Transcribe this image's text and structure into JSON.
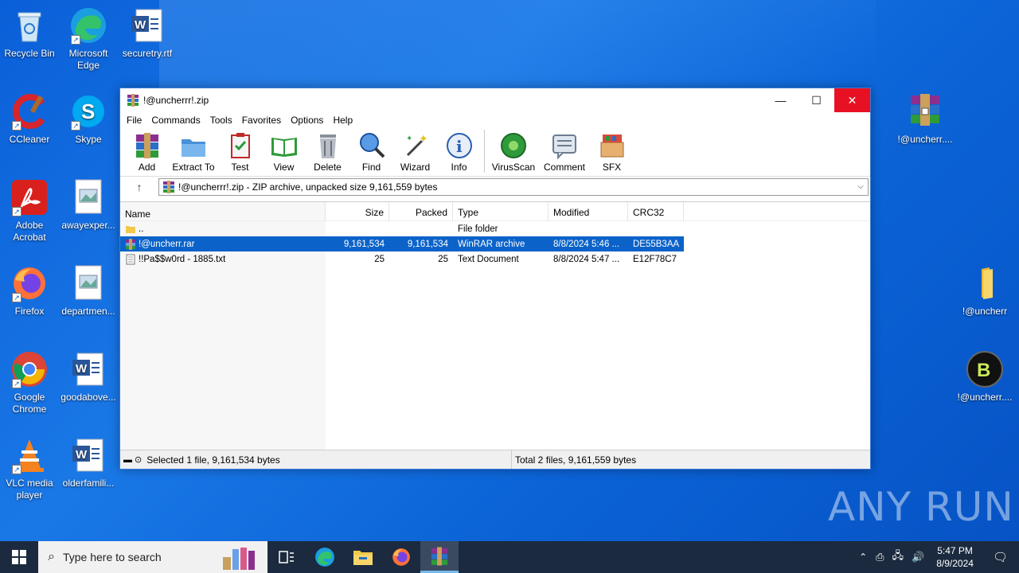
{
  "desktop": {
    "icons_left": [
      {
        "label": "Recycle Bin",
        "icon": "recycle-bin-icon"
      },
      {
        "label": "Microsoft Edge",
        "icon": "edge-icon"
      },
      {
        "label": "securetry.rtf",
        "icon": "word-doc-icon"
      },
      {
        "label": "CCleaner",
        "icon": "ccleaner-icon"
      },
      {
        "label": "Skype",
        "icon": "skype-icon"
      },
      {
        "label": "Adobe Acrobat",
        "icon": "acrobat-icon"
      },
      {
        "label": "awayexper...",
        "icon": "image-file-icon"
      },
      {
        "label": "Firefox",
        "icon": "firefox-icon"
      },
      {
        "label": "departmen...",
        "icon": "image-file-icon"
      },
      {
        "label": "Google Chrome",
        "icon": "chrome-icon"
      },
      {
        "label": "goodabove...",
        "icon": "word-doc-icon"
      },
      {
        "label": "VLC media player",
        "icon": "vlc-icon"
      },
      {
        "label": "olderfamili...",
        "icon": "word-doc-icon"
      }
    ],
    "icons_right": [
      {
        "label": "!@uncherr....",
        "icon": "winrar-archive-icon"
      },
      {
        "label": "!@uncherr",
        "icon": "folder-icon"
      },
      {
        "label": "!@uncherr....",
        "icon": "bitcoin-app-icon"
      }
    ],
    "watermark": "ANY RUN"
  },
  "window": {
    "title": "!@uncherrr!.zip",
    "menu": [
      "File",
      "Commands",
      "Tools",
      "Favorites",
      "Options",
      "Help"
    ],
    "toolbar": [
      {
        "label": "Add",
        "icon": "add-archive-icon"
      },
      {
        "label": "Extract To",
        "icon": "extract-folder-icon"
      },
      {
        "label": "Test",
        "icon": "test-clipboard-icon"
      },
      {
        "label": "View",
        "icon": "view-book-icon"
      },
      {
        "label": "Delete",
        "icon": "trash-icon"
      },
      {
        "label": "Find",
        "icon": "magnifier-icon"
      },
      {
        "label": "Wizard",
        "icon": "wand-icon"
      },
      {
        "label": "Info",
        "icon": "info-icon"
      },
      {
        "label": "VirusScan",
        "icon": "virus-scan-icon"
      },
      {
        "label": "Comment",
        "icon": "comment-icon"
      },
      {
        "label": "SFX",
        "icon": "sfx-box-icon"
      }
    ],
    "address": "!@uncherrr!.zip - ZIP archive, unpacked size 9,161,559 bytes",
    "columns": [
      "Name",
      "Size",
      "Packed",
      "Type",
      "Modified",
      "CRC32"
    ],
    "rows": [
      {
        "name": "..",
        "size": "",
        "packed": "",
        "type": "File folder",
        "modified": "",
        "crc": "",
        "icon": "folder-icon",
        "selected": false
      },
      {
        "name": "!@uncherr.rar",
        "size": "9,161,534",
        "packed": "9,161,534",
        "type": "WinRAR archive",
        "modified": "8/8/2024 5:46 ...",
        "crc": "DE55B3AA",
        "icon": "winrar-archive-icon",
        "selected": true
      },
      {
        "name": "!!Pa$$w0rd  -  1885.txt",
        "size": "25",
        "packed": "25",
        "type": "Text Document",
        "modified": "8/8/2024 5:47 ...",
        "crc": "E12F78C7",
        "icon": "text-file-icon",
        "selected": false
      }
    ],
    "status_left": "Selected 1 file, 9,161,534 bytes",
    "status_right": "Total 2 files, 9,161,559 bytes"
  },
  "taskbar": {
    "search_placeholder": "Type here to search",
    "time": "5:47 PM",
    "date": "8/9/2024"
  }
}
